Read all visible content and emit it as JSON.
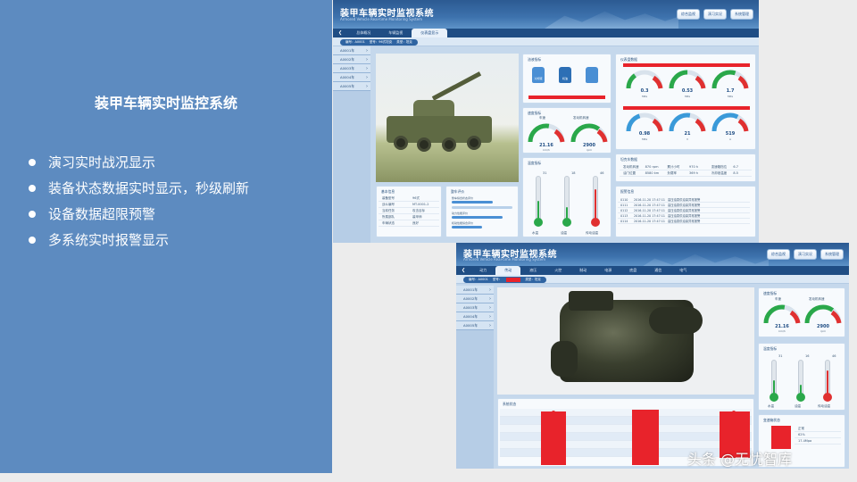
{
  "slide": {
    "title": "装甲车辆实时监控系统",
    "bullets": [
      "演习实时战况显示",
      "装备状态数据实时显示，秒级刷新",
      "设备数据超限预警",
      "多系统实时报警显示"
    ]
  },
  "screen1": {
    "app_title": "装甲车辆实时监视系统",
    "app_subtitle": "Armored Vehicle Real-time Monitoring System",
    "header_buttons": [
      "综合监视",
      "演习实况",
      "系统管理"
    ],
    "tabs": [
      "总体概况",
      "车辆监视",
      "仪表盘显示"
    ],
    "active_tab_index": 2,
    "info": {
      "id_label": "编号：A0001",
      "type_label": "型号：96式坦克",
      "class_label": "类型：坦克"
    },
    "sidebar": [
      "A0001车",
      "A0002车",
      "A0003车",
      "A0004车",
      "A0005车"
    ],
    "liquid_card": {
      "title": "油液指标",
      "bottles": [
        "冷却液",
        "机油"
      ]
    },
    "speed_card": {
      "title": "速度指标",
      "gauges": [
        {
          "label": "车速",
          "value": "21.16",
          "unit": "km/h",
          "fill": 0.55
        },
        {
          "label": "发动机转速",
          "value": "2900",
          "unit": "rpm",
          "fill": 0.7
        }
      ]
    },
    "temp_card": {
      "title": "温度指标",
      "thermometers": [
        {
          "label": "水温",
          "value": "31",
          "level": 0.45,
          "color": "#2aa84a"
        },
        {
          "label": "油温",
          "value": "18",
          "level": 0.3,
          "color": "#2aa84a"
        },
        {
          "label": "传动油温",
          "value": "46",
          "level": 0.75,
          "color": "#e03030"
        }
      ]
    },
    "instrument_card": {
      "title": "仪表盘数据",
      "gauges": [
        {
          "value": "0.3",
          "unit": "MPa",
          "fill": 0.3
        },
        {
          "value": "0.53",
          "unit": "MPa",
          "fill": 0.5
        },
        {
          "value": "1.7",
          "unit": "MPa",
          "fill": 0.6
        },
        {
          "value": "0.98",
          "unit": "MPa",
          "fill": 0.4
        },
        {
          "value": "21",
          "unit": "V",
          "fill": 0.55
        },
        {
          "value": "519",
          "unit": "A",
          "fill": 0.65
        }
      ]
    },
    "vehicle_data": {
      "title": "坦克车数据",
      "rows": [
        [
          "发动机转速",
          "870 rpm",
          "累计小时",
          "970 h",
          "变速箱档位",
          "6.7"
        ],
        [
          "油门位置",
          "8580 km",
          "负载率",
          "369 h",
          "冷却液温度",
          "8.5"
        ]
      ]
    },
    "basic_info": {
      "title": "基本信息",
      "rows": [
        [
          "装备型号",
          "96式"
        ],
        [
          "战斗编号",
          "MT-0001-2"
        ],
        [
          "当前任务",
          "攻击目标"
        ],
        [
          "所属部队",
          "装甲师"
        ],
        [
          "车辆状态",
          "良好"
        ]
      ]
    },
    "eval_card": {
      "title": "整车评价",
      "items": [
        "整车综合状态评价",
        "动力性能评价",
        "机动性能综合评价"
      ]
    },
    "alarm_card": {
      "title": "报警信息",
      "rows": [
        [
          "0110",
          "2016-11-20 17:47:11",
          "高压油泵供油量异常报警"
        ],
        [
          "0111",
          "2016-11-20 17:47:11",
          "高压油泵供油量异常报警"
        ],
        [
          "0112",
          "2016-11-20 17:47:11",
          "高压油泵供油量异常报警"
        ],
        [
          "0113",
          "2016-11-20 17:47:11",
          "高压油泵供油量异常报警"
        ],
        [
          "0114",
          "2016-11-20 17:47:11",
          "高压油泵供油量异常报警"
        ]
      ]
    }
  },
  "screen2": {
    "app_title": "装甲车辆实时监视系统",
    "app_subtitle": "Armored Vehicle Real-time Monitoring System",
    "header_buttons": [
      "综合监视",
      "演习实况",
      "系统管理"
    ],
    "tabs": [
      "动力",
      "传动",
      "液压",
      "火控",
      "制动",
      "电源",
      "底盘",
      "通信",
      "电气"
    ],
    "active_tab_index": 1,
    "info": {
      "id_label": "编号：A0001",
      "type_label": "型号：",
      "class_label": "类型：坦克"
    },
    "sidebar": [
      "A0001车",
      "A0002车",
      "A0003车",
      "A0004车",
      "A0005车"
    ],
    "speed_card": {
      "title": "速度指标",
      "gauges": [
        {
          "label": "车速",
          "value": "21.16",
          "unit": "km/h",
          "fill": 0.55
        },
        {
          "label": "发动机转速",
          "value": "2900",
          "unit": "rpm",
          "fill": 0.7
        }
      ]
    },
    "temp_card": {
      "title": "温度指标",
      "thermometers": [
        {
          "label": "水温",
          "value": "31",
          "level": 0.45,
          "color": "#2aa84a"
        },
        {
          "label": "油温",
          "value": "16",
          "level": 0.3,
          "color": "#2aa84a"
        },
        {
          "label": "传动油温",
          "value": "46",
          "level": 0.75,
          "color": "#e03030"
        }
      ]
    },
    "status_card": {
      "title": "系统状态"
    },
    "trans_card": {
      "title": "变速箱状态",
      "rows": [
        [
          "",
          "正常"
        ],
        [
          "",
          "62%"
        ],
        [
          "",
          "17.4Mpa"
        ]
      ]
    }
  },
  "watermark": "头条 @无忧智库",
  "colors": {
    "panel_blue": "#5d8bc0",
    "alert_red": "#e8232b",
    "header_blue": "#2c5a92"
  }
}
